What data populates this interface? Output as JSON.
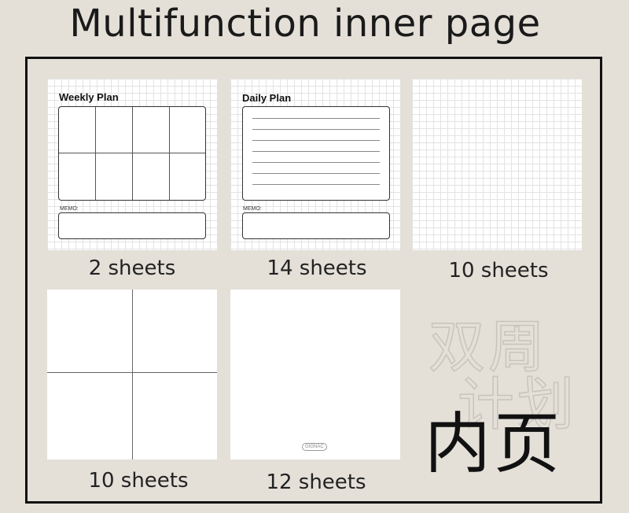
{
  "title": "Multifunction inner page",
  "pages": [
    {
      "name": "weekly-plan",
      "heading": "Weekly Plan",
      "memo": "MEMO:",
      "caption": "2 sheets"
    },
    {
      "name": "daily-plan",
      "heading": "Daily  Plan",
      "memo": "MEMO:",
      "caption": "14 sheets"
    },
    {
      "name": "grid",
      "caption": "10 sheets"
    },
    {
      "name": "quadrant",
      "caption": "10 sheets"
    },
    {
      "name": "blank",
      "logo": "GIGNAC",
      "caption": "12 sheets"
    }
  ],
  "watermark": {
    "line1": "双周",
    "line2": "计划"
  },
  "label_cn": "内页",
  "colors": {
    "background": "#e4e0d8",
    "frame": "#111111",
    "sheet": "#ffffff"
  }
}
